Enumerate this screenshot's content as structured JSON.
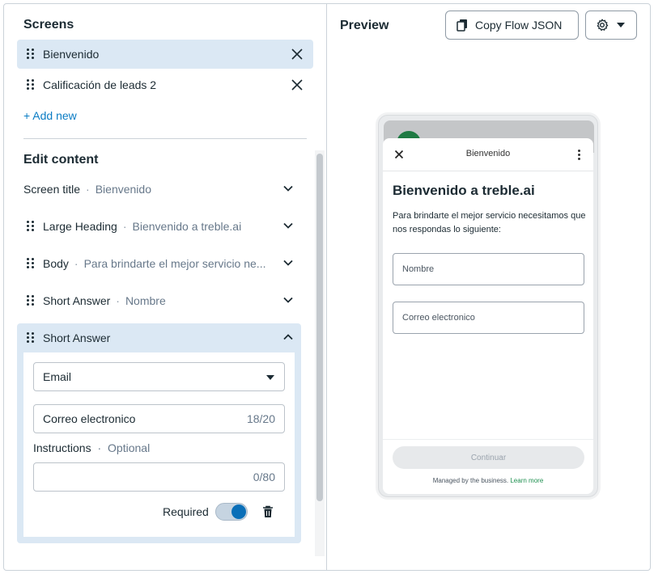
{
  "screens": {
    "title": "Screens",
    "items": [
      {
        "label": "Bienvenido"
      },
      {
        "label": "Calificación de leads 2"
      }
    ],
    "add_new": "+ Add new"
  },
  "edit": {
    "title": "Edit content",
    "rows": [
      {
        "label": "Screen title",
        "sep": "·",
        "value": "Bienvenido"
      },
      {
        "label": "Large Heading",
        "sep": "·",
        "value": "Bienvenido a treble.ai"
      },
      {
        "label": "Body",
        "sep": "·",
        "value": "Para brindarte el mejor servicio ne..."
      },
      {
        "label": "Short Answer",
        "sep": "·",
        "value": "Nombre"
      }
    ],
    "expanded": {
      "label": "Short Answer",
      "type_value": "Email",
      "label_value": "Correo electronico",
      "label_count": "18/20",
      "instructions_label": "Instructions",
      "instructions_sep": "·",
      "instructions_optional": "Optional",
      "instructions_count": "0/80",
      "required_label": "Required",
      "required": true
    }
  },
  "preview": {
    "title": "Preview",
    "copy_button": "Copy Flow JSON",
    "phone": {
      "header_title": "Bienvenido",
      "heading": "Bienvenido a treble.ai",
      "body": "Para brindarte el mejor servicio necesitamos que nos respondas lo siguiente:",
      "input1": "Nombre",
      "input2": "Correo electronico",
      "button": "Continuar",
      "managed": "Managed by the business.",
      "learn_more": "Learn more"
    }
  },
  "colors": {
    "accent": "#0a7cc4",
    "selected_bg": "#dbe8f4",
    "toggle_on": "#0a6fb8",
    "link_green": "#1d8f4f"
  }
}
